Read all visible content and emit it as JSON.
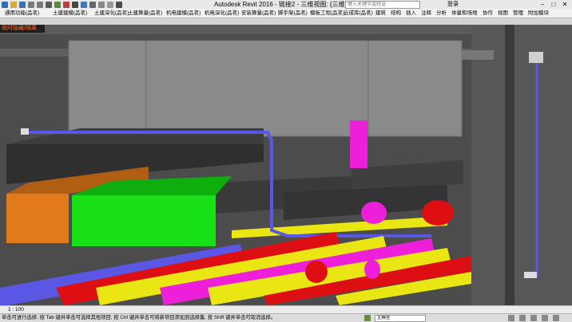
{
  "window": {
    "title": "Autodesk Revit 2016 -  链接2 - 三维视图: {三维}1",
    "login_label": "登录",
    "controls": [
      "−",
      "□",
      "✕"
    ]
  },
  "search": {
    "placeholder": "键入关键字或短语"
  },
  "ribbon": {
    "tabs": [
      "通用功能(品茗)",
      "土建建模(品茗)",
      "土建深化(品茗)",
      "土建算量(品茗)",
      "机电建模(品茗)",
      "机电深化(品茗)",
      "安装算量(品茗)",
      "脚手架(品茗)",
      "模板工程(品茗)",
      "云成库(品茗)",
      "建筑",
      "结构",
      "插入",
      "注释",
      "分析",
      "体量和场地",
      "协作",
      "视图",
      "管理",
      "附加模块"
    ]
  },
  "view": {
    "tab_label": "临时隐藏/隔离"
  },
  "viewbar": {
    "scale": "1 : 100"
  },
  "status": {
    "message": "单击可进行选择; 按 Tab 键并单击可选择其他项目; 按 Ctrl 键并单击可将新项目添加到选择集; 按 Shift 键并单击可取消选择。",
    "model_field": "主模型"
  },
  "colors": {
    "orange_duct": "#e07a1a",
    "green_duct": "#17e017",
    "red_pipe": "#dd0f12",
    "yellow_pipe": "#e9e613",
    "magenta_pipe": "#ee1fd9",
    "blue_pipe": "#5b57e5",
    "concrete": "#8a8a8a"
  }
}
